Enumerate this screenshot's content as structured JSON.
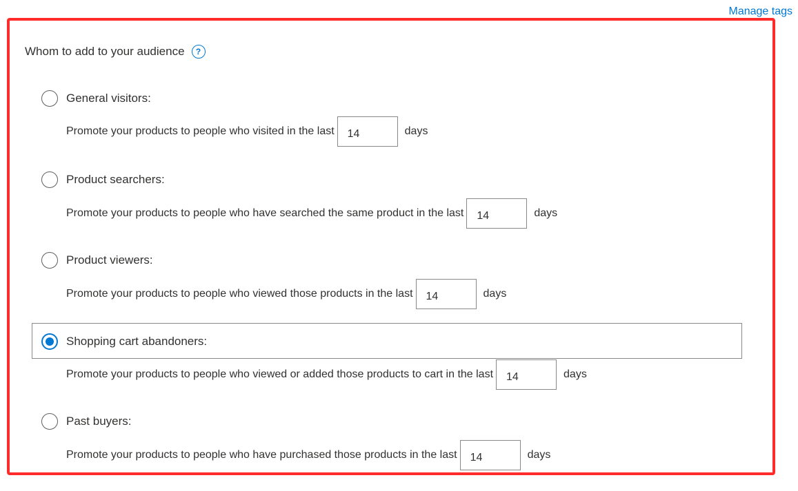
{
  "manage_tags": "Manage tags",
  "section_title": "Whom to add to your audience",
  "help_icon": "?",
  "options": [
    {
      "label": "General visitors:",
      "description": "Promote your products to people who visited in the last",
      "days": "14",
      "unit": "days",
      "selected": false
    },
    {
      "label": "Product searchers:",
      "description": "Promote your products to people who have searched the same product in the last",
      "days": "14",
      "unit": "days",
      "selected": false
    },
    {
      "label": "Product viewers:",
      "description": "Promote your products to people who viewed those products in the last",
      "days": "14",
      "unit": "days",
      "selected": false
    },
    {
      "label": "Shopping cart abandoners:",
      "description": "Promote your products to people who viewed or added those products to cart in the last",
      "days": "14",
      "unit": "days",
      "selected": true
    },
    {
      "label": "Past buyers:",
      "description": "Promote your products to people who have purchased those products in the last",
      "days": "14",
      "unit": "days",
      "selected": false
    }
  ],
  "colors": {
    "accent": "#0078d4",
    "highlight_border": "#ff2a2a",
    "text": "#323130"
  }
}
